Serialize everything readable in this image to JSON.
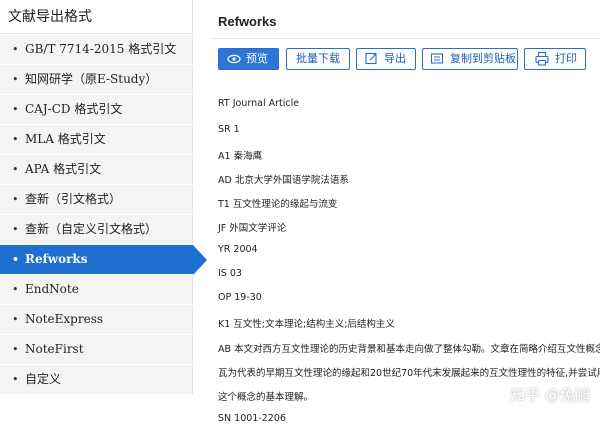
{
  "sidebar": {
    "title": "文献导出格式",
    "items": [
      {
        "label": "GB/T 7714-2015 格式引文",
        "active": false
      },
      {
        "label": "知网研学（原E-Study）",
        "active": false
      },
      {
        "label": "CAJ-CD 格式引文",
        "active": false
      },
      {
        "label": "MLA 格式引文",
        "active": false
      },
      {
        "label": "APA 格式引文",
        "active": false
      },
      {
        "label": "查新（引文格式）",
        "active": false
      },
      {
        "label": "查新（自定义引文格式）",
        "active": false
      },
      {
        "label": "Refworks",
        "active": true
      },
      {
        "label": "EndNote",
        "active": false
      },
      {
        "label": "NoteExpress",
        "active": false
      },
      {
        "label": "NoteFirst",
        "active": false
      },
      {
        "label": "自定义",
        "active": false
      }
    ]
  },
  "main": {
    "title": "Refworks",
    "toolbar": {
      "preview": "预览",
      "batch_download": "批量下载",
      "export": "导出",
      "copy_clipboard": "复制到剪贴板",
      "print": "打印"
    },
    "lines": [
      "RT Journal Article",
      "SR 1",
      "A1 秦海鹰",
      "AD 北京大学外国语学院法语系",
      "T1 互文性理论的缘起与流变",
      "JF 外国文学评论",
      "YR 2004",
      "IS 03",
      "OP 19-30",
      "K1 互文性;文本理论;结构主义;后结构主义",
      "AB 本文对西方互文性理论的历史背景和基本走向做了整体勾勒。文章在简略介绍互文性概念的",
      "瓦为代表的早期互文性理论的缘起和20世纪70年代末发展起来的互文性理性的特征,并尝试用自己",
      "这个概念的基本理解。",
      "SN 1001-2206"
    ]
  },
  "watermark": "知乎 @兔腿",
  "icons": {
    "preview": "eye-icon",
    "export": "export-icon",
    "copy": "copy-icon",
    "print": "printer-icon"
  },
  "colors": {
    "accent": "#1f6fd1",
    "button_border": "#2d6dc6",
    "sidebar_bg": "#f4f4f4"
  }
}
